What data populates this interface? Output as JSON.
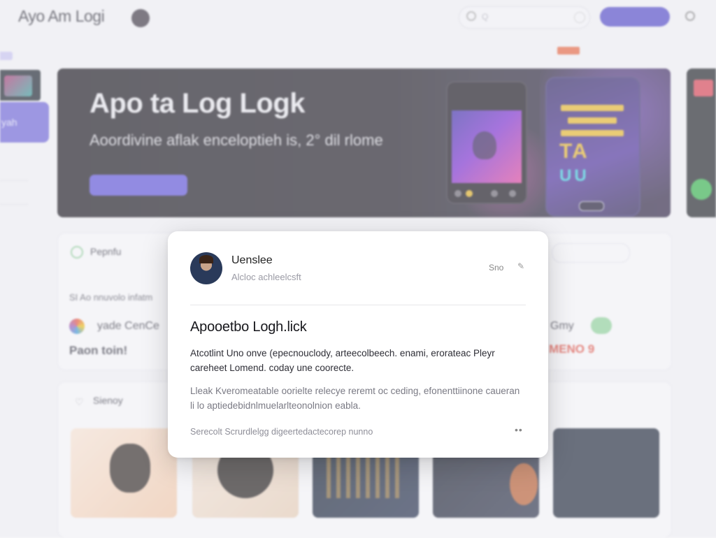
{
  "header": {
    "app_name": "Ayo Am Logi",
    "nav_text": "",
    "search_placeholder": "Q",
    "cta_label": "",
    "breadcrumb": "",
    "breadcrumb_badge": "",
    "breadcrumb_right": ""
  },
  "sidebar": {
    "active_label": "yah"
  },
  "hero": {
    "title": "Apo ta Log Logk",
    "subtitle": "Aoordivine aflak enceloptieh is, 2° dil rlome",
    "description": "",
    "button_label": "",
    "phone_title": "",
    "poster_tag": "",
    "poster_text1": "TA",
    "poster_text2": "UU"
  },
  "section1": {
    "title": "Pepnfu",
    "subtitle": "SI Ao nnuvolo infatm",
    "item_name": "yade CenCe",
    "item_price": "Paon toin!",
    "button_label": "",
    "link_label": "",
    "right_item_name": "Gmy",
    "right_item_price": "MENO 9"
  },
  "section2": {
    "title": "Sienoy",
    "thumb5_line1": "",
    "thumb5_line2": ""
  },
  "modal": {
    "user_name": "Uenslee",
    "user_handle": "Alcloc achleelcsft",
    "action_label": "Sno",
    "edit_icon": "pencil-icon",
    "title": "Apooetbo Logh.lick",
    "paragraph1": "Atcotlint Uno onve (epecnouclody, arteecolbeech. enami, erorateac Pleyr careheet Lomend. coday une coorecte.",
    "paragraph2": "Lleak Kveromeatable oorielte relecye reremt oc ceding, efonenttiinone caueran li lo aptiedebidnlmuelarlteonolnion eabla.",
    "footer": "Serecolt Scrurdlelgg digeertedactecorep   nunno",
    "more_label": "••"
  },
  "colors": {
    "accent": "#4f46c8",
    "hero_button": "#5b4fd8",
    "badge": "#e8643f",
    "price_red": "#e04a3c"
  }
}
